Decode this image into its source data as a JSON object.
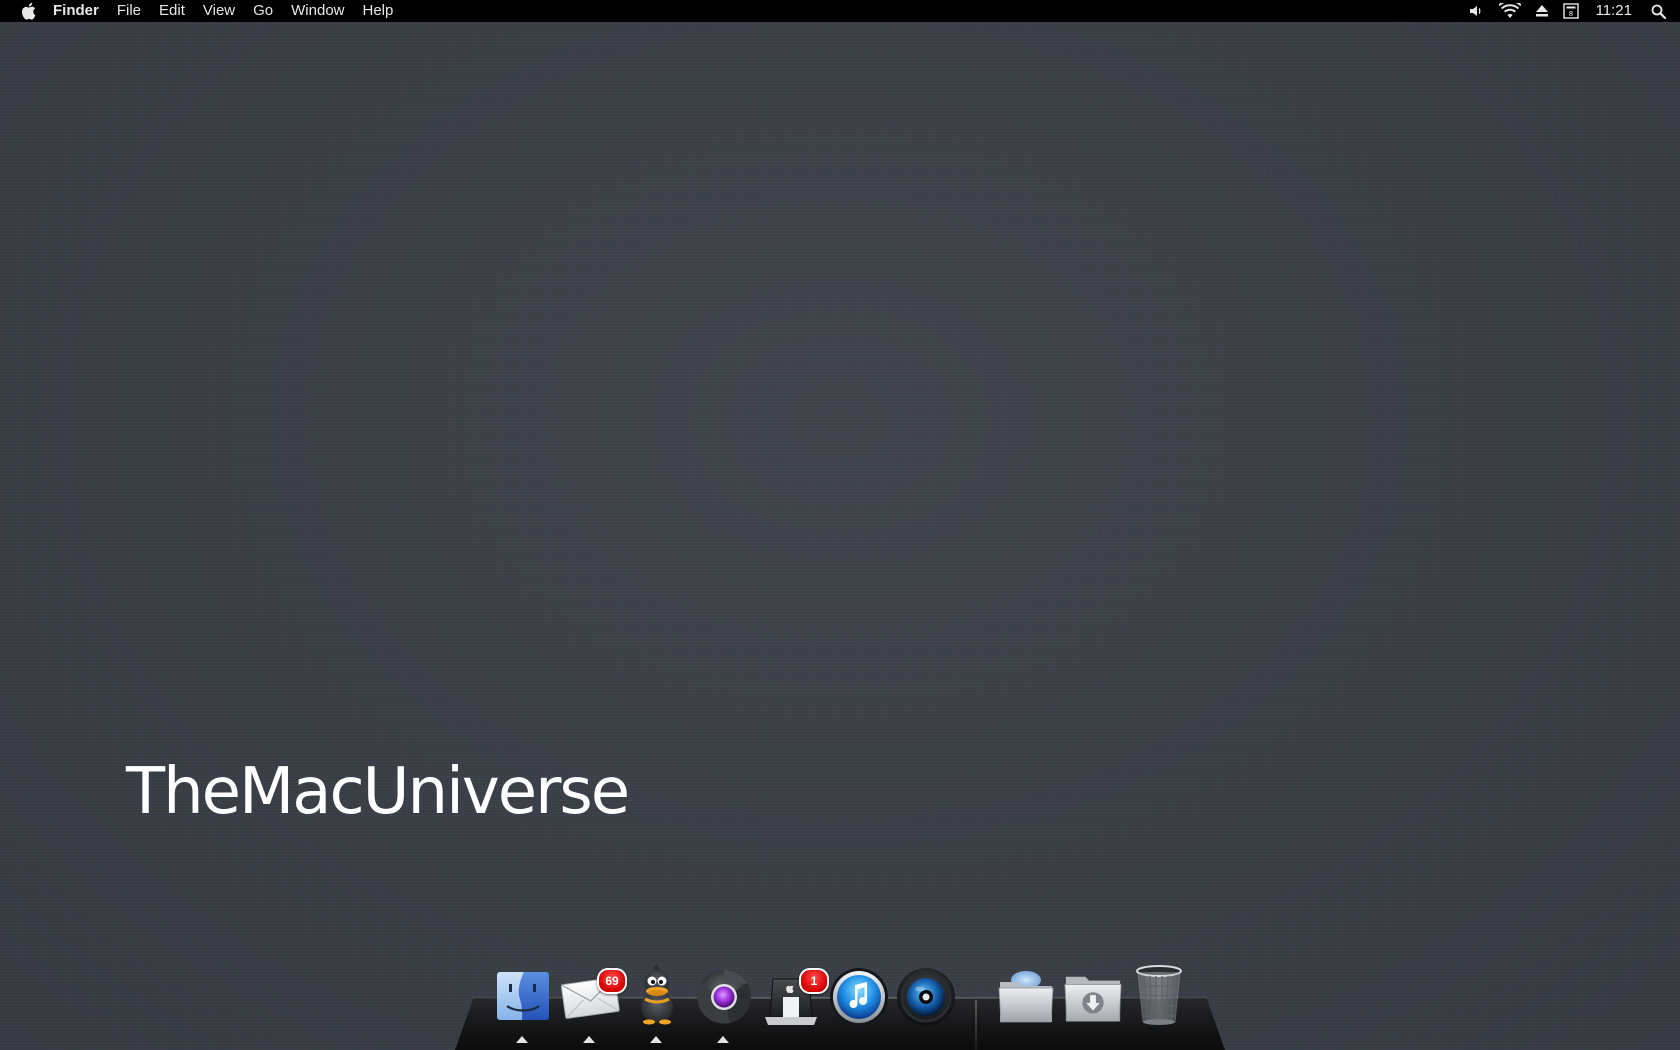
{
  "menubar": {
    "apple_icon": "apple-icon",
    "app_name": "Finder",
    "menus": [
      "File",
      "Edit",
      "View",
      "Go",
      "Window",
      "Help"
    ],
    "status_icons": [
      "volume-icon",
      "wifi-icon",
      "eject-icon",
      "notification-icon"
    ],
    "clock": "11:21",
    "search_icon": "spotlight-search-icon"
  },
  "desktop": {
    "watermark": "TheMacUniverse",
    "background_color": "#3a3e47"
  },
  "dock": {
    "apps": [
      {
        "name": "finder",
        "running": true
      },
      {
        "name": "mail",
        "running": true,
        "badge": "69"
      },
      {
        "name": "adium",
        "running": true
      },
      {
        "name": "chrome",
        "running": true
      },
      {
        "name": "app-store",
        "running": false,
        "badge": "1"
      },
      {
        "name": "itunes",
        "running": false
      },
      {
        "name": "aperture",
        "running": false
      }
    ],
    "stacks": [
      {
        "name": "applications-folder"
      },
      {
        "name": "downloads-folder"
      },
      {
        "name": "trash"
      }
    ]
  }
}
